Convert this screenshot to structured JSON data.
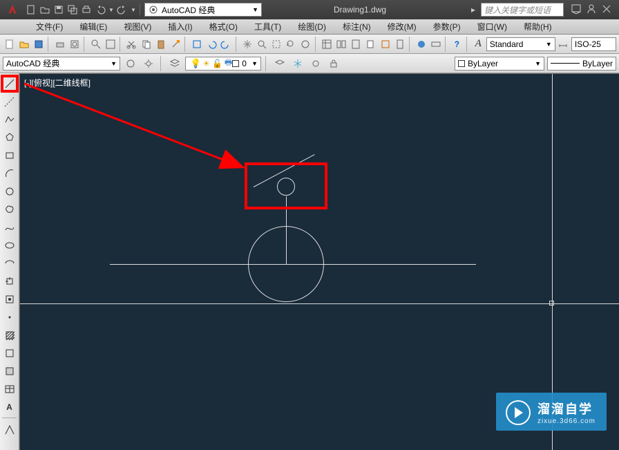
{
  "title": "Drawing1.dwg",
  "search_placeholder": "键入关键字或短语",
  "workspace": "AutoCAD 经典",
  "menus": {
    "file": "文件(F)",
    "edit": "编辑(E)",
    "view": "视图(V)",
    "insert": "插入(I)",
    "format": "格式(O)",
    "tools": "工具(T)",
    "draw": "绘图(D)",
    "dimension": "标注(N)",
    "modify": "修改(M)",
    "param": "参数(P)",
    "window": "窗口(W)",
    "help": "帮助(H)"
  },
  "text_style": "Standard",
  "dim_style": "ISO-25",
  "workspace_prop": "AutoCAD 经典",
  "layer_name": "0",
  "color_prop": "ByLayer",
  "linetype_prop": "ByLayer",
  "viewport_label": "[-][俯视][二维线框]",
  "watermark": {
    "main": "溜溜自学",
    "sub": "zixue.3d66.com"
  },
  "chart_data": null
}
